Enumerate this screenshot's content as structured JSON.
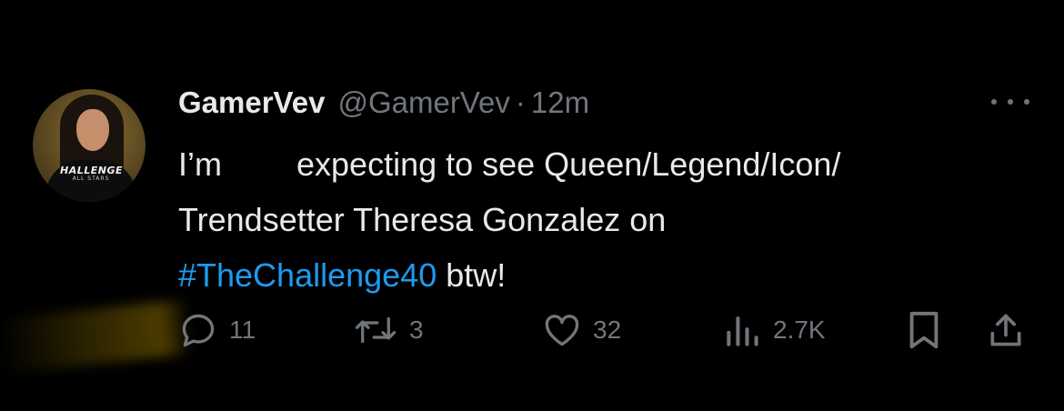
{
  "tweet": {
    "author_name": "GamerVev",
    "handle": "@GamerVev",
    "separator": "·",
    "time": "12m",
    "avatar": {
      "logo_text": "HALLENGE",
      "logo_subtext": "ALL STARS"
    },
    "text": {
      "line1_start": "I’m",
      "line1_end": "expecting to see Queen/Legend/Icon/",
      "line2": "Trendsetter Theresa Gonzalez on",
      "hashtag": "#TheChallenge40",
      "line3_end": " btw!"
    }
  },
  "actions": {
    "reply": {
      "icon": "reply-icon",
      "count": "11"
    },
    "retweet": {
      "icon": "retweet-icon",
      "count": "3"
    },
    "like": {
      "icon": "heart-icon",
      "count": "32"
    },
    "views": {
      "icon": "views-icon",
      "count": "2.7K"
    },
    "bookmark": {
      "icon": "bookmark-icon"
    },
    "share": {
      "icon": "share-icon"
    }
  },
  "colors": {
    "background": "#000000",
    "text": "#e7e9ea",
    "muted": "#71767b",
    "accent": "#1d9bf0"
  }
}
